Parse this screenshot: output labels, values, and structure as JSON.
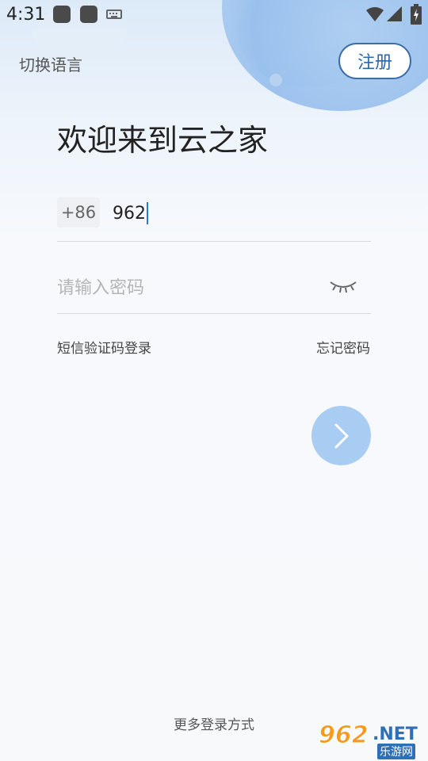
{
  "status_bar": {
    "time": "4:31"
  },
  "header": {
    "language_link": "切换语言",
    "register_button": "注册"
  },
  "welcome": {
    "title": "欢迎来到云之家"
  },
  "login_form": {
    "country_code": "+86",
    "phone_value": "962",
    "password_placeholder": "请输入密码",
    "sms_login_link": "短信验证码登录",
    "forgot_password_link": "忘记密码"
  },
  "footer": {
    "more_login_methods": "更多登录方式"
  },
  "watermark": {
    "brand_number": "962",
    "brand_suffix": ".NET",
    "brand_cn": "乐游网"
  },
  "colors": {
    "accent": "#2f67a8",
    "next_button": "#a9ccf3",
    "caret": "#2a7bd0"
  },
  "icons": [
    "wifi-icon",
    "signal-icon",
    "battery-icon",
    "keyboard-icon",
    "eye-closed-icon",
    "chevron-right-icon"
  ]
}
